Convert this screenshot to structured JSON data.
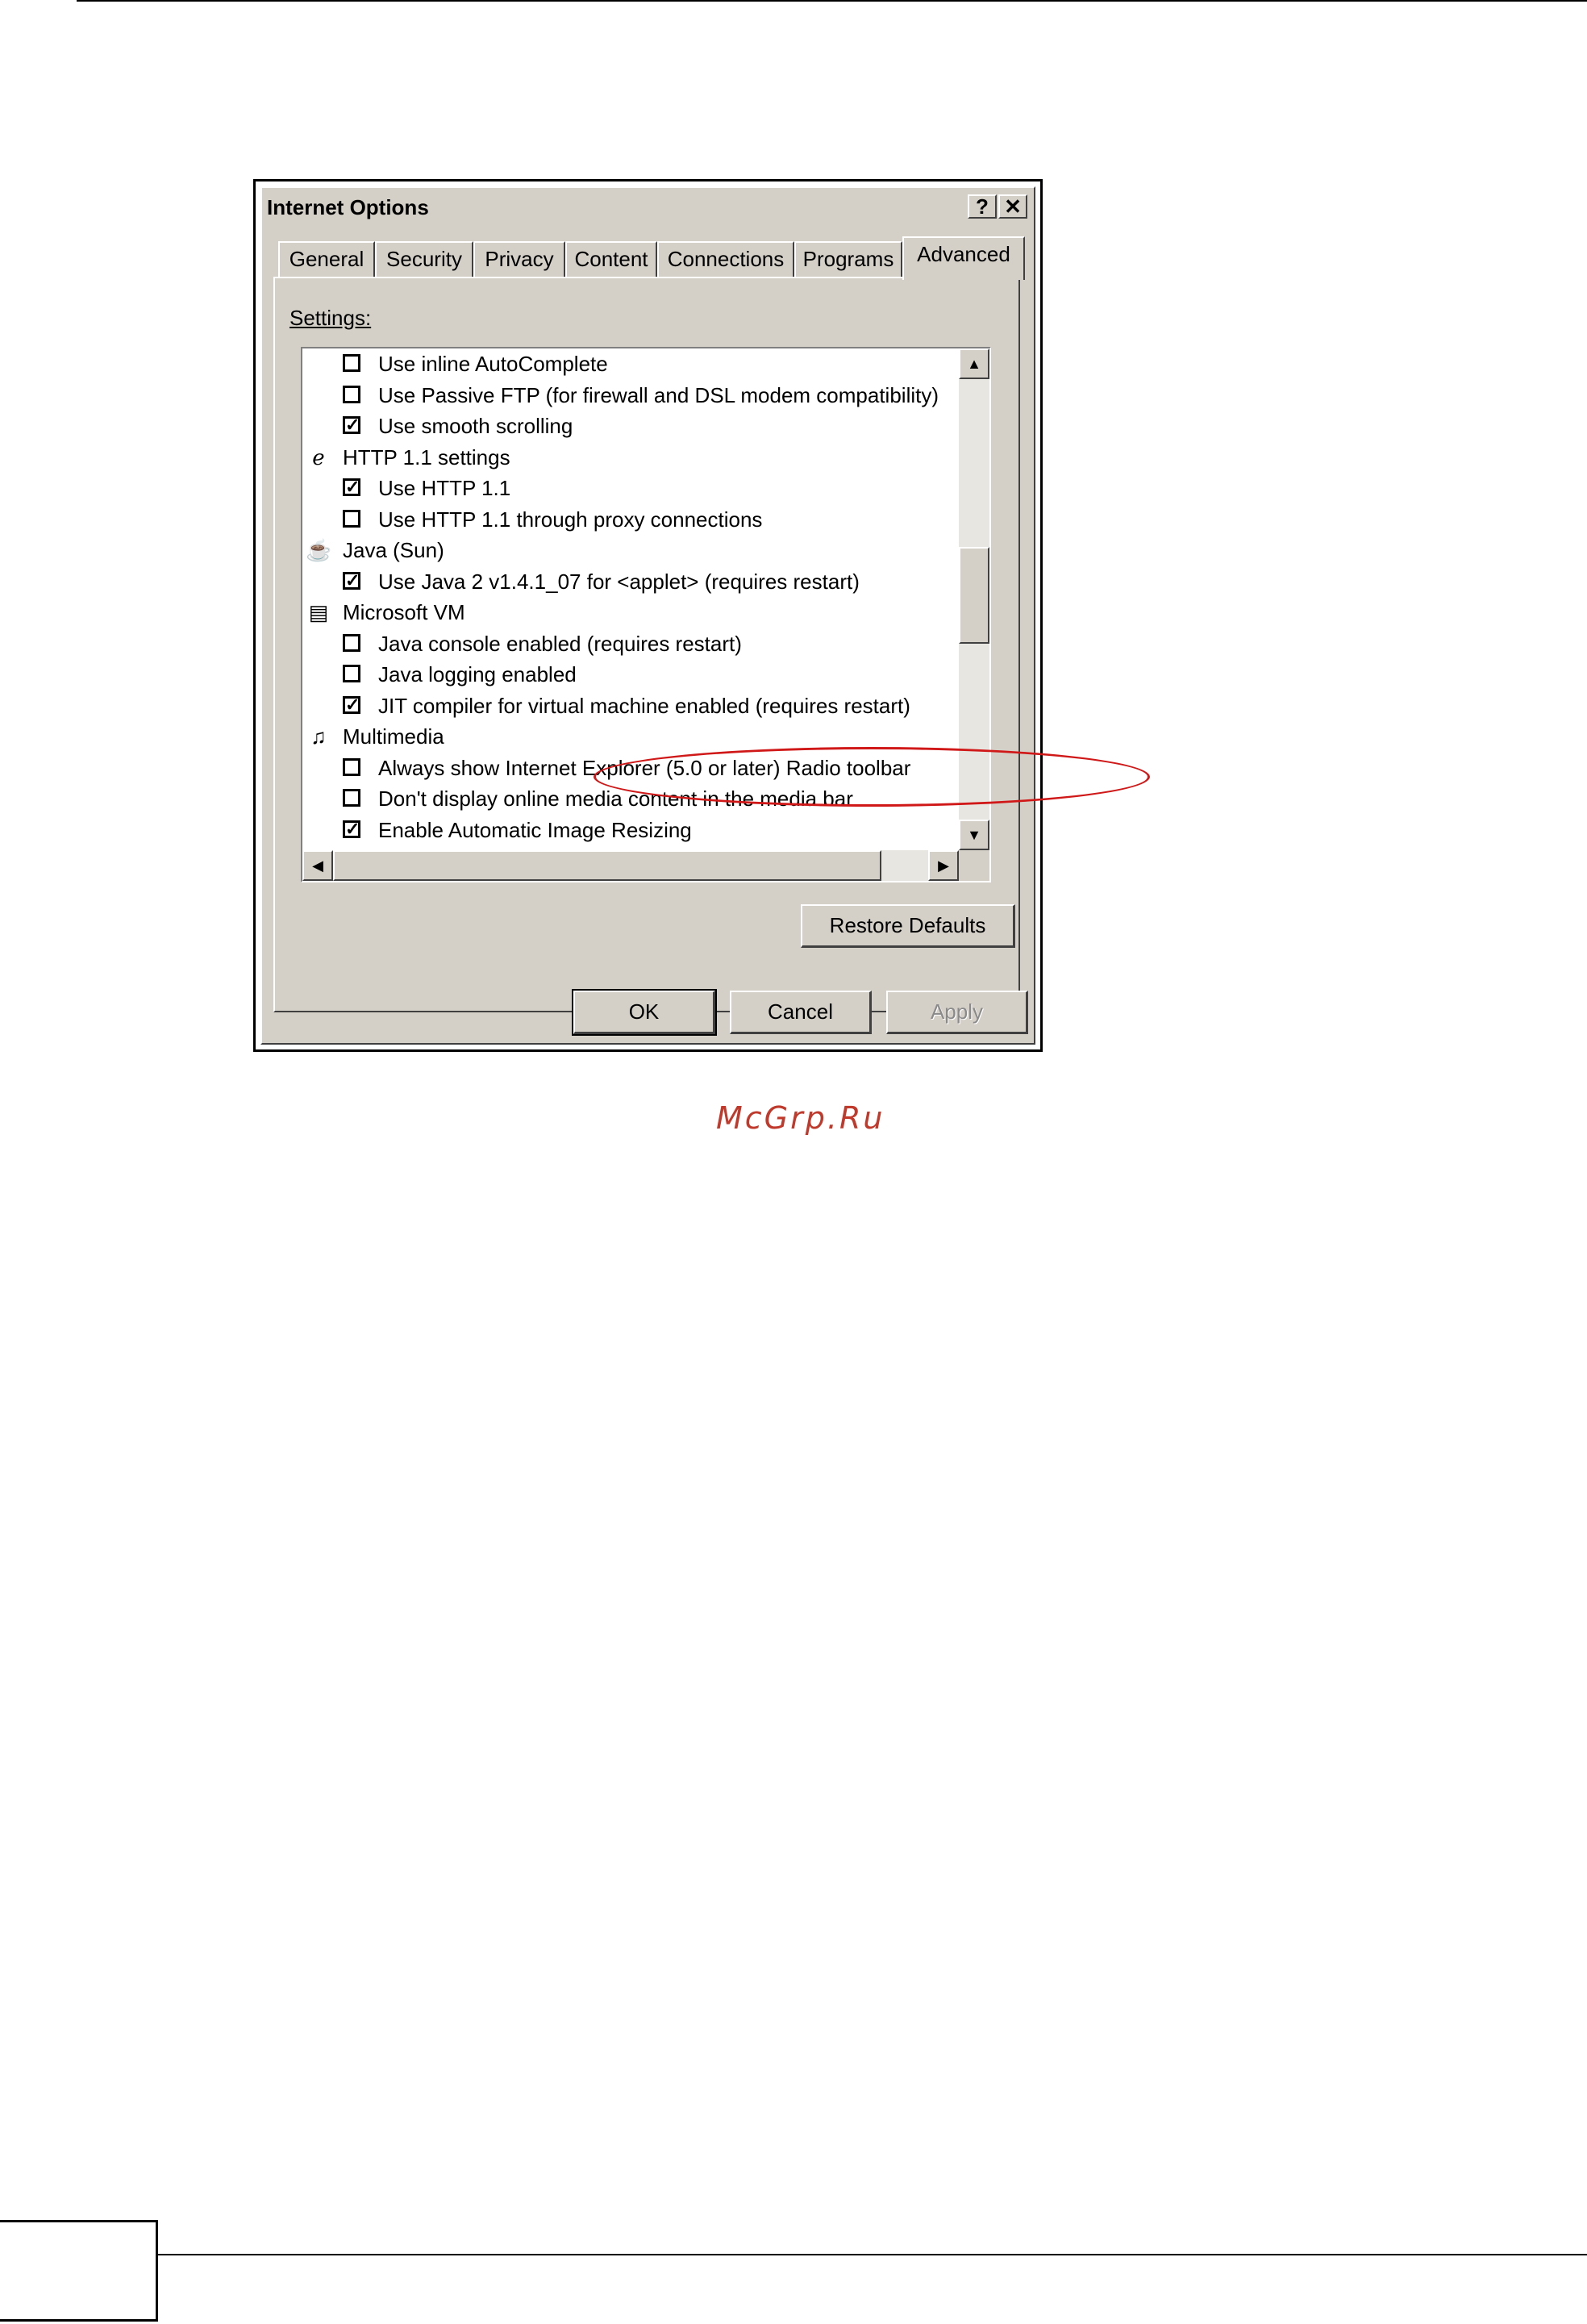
{
  "window": {
    "title": "Internet Options",
    "help_button": "?",
    "close_button": "✕"
  },
  "tabs": [
    "General",
    "Security",
    "Privacy",
    "Content",
    "Connections",
    "Programs",
    "Advanced"
  ],
  "active_tab": "Advanced",
  "settings_label": "Settings:",
  "settings_items": [
    {
      "type": "option",
      "label": "Use inline AutoComplete",
      "checked": false
    },
    {
      "type": "option",
      "label": "Use Passive FTP (for firewall and DSL modem compatibility)",
      "checked": false
    },
    {
      "type": "option",
      "label": "Use smooth scrolling",
      "checked": true
    },
    {
      "type": "category",
      "label": "HTTP 1.1 settings",
      "icon": "ie-icon"
    },
    {
      "type": "option",
      "label": "Use HTTP 1.1",
      "checked": true
    },
    {
      "type": "option",
      "label": "Use HTTP 1.1 through proxy connections",
      "checked": false
    },
    {
      "type": "category",
      "label": "Java (Sun)",
      "icon": "java-icon"
    },
    {
      "type": "option",
      "label": "Use Java 2 v1.4.1_07 for <applet> (requires restart)",
      "checked": true,
      "highlighted": true
    },
    {
      "type": "category",
      "label": "Microsoft VM",
      "icon": "document-icon"
    },
    {
      "type": "option",
      "label": "Java console enabled (requires restart)",
      "checked": false
    },
    {
      "type": "option",
      "label": "Java logging enabled",
      "checked": false
    },
    {
      "type": "option",
      "label": "JIT compiler for virtual machine enabled (requires restart)",
      "checked": true
    },
    {
      "type": "category",
      "label": "Multimedia",
      "icon": "multimedia-icon"
    },
    {
      "type": "option",
      "label": "Always show Internet Explorer (5.0 or later) Radio toolbar",
      "checked": false
    },
    {
      "type": "option",
      "label": "Don't display online media content in the media bar",
      "checked": false
    },
    {
      "type": "option",
      "label": "Enable Automatic Image Resizing",
      "checked": true
    }
  ],
  "buttons": {
    "restore_defaults": "Restore Defaults",
    "ok": "OK",
    "cancel": "Cancel",
    "apply": "Apply"
  },
  "watermark": "McGrp.Ru",
  "colors": {
    "dialog_face": "#d4d0c8",
    "highlight_ellipse": "#d01818",
    "watermark": "#c0392b"
  }
}
